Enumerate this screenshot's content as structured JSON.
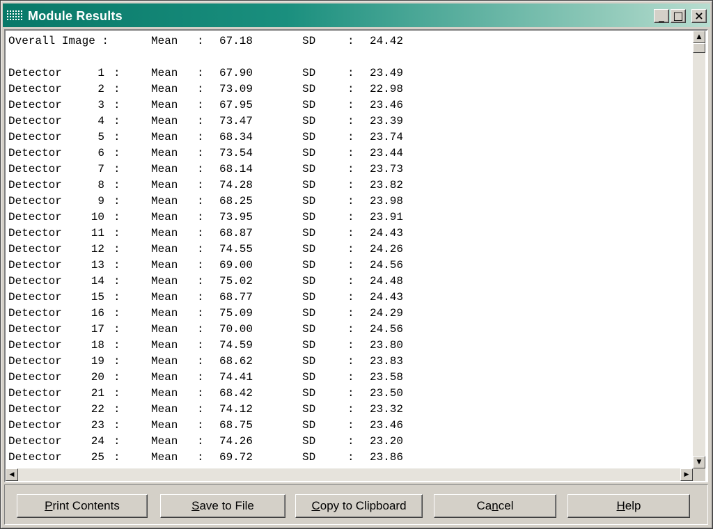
{
  "window": {
    "title": "Module Results",
    "controls": {
      "minimize": "_",
      "maximize": "□",
      "close": "×"
    }
  },
  "overall": {
    "label": "Overall Image :",
    "mean_label": "Mean",
    "mean": "67.18",
    "sd_label": "SD",
    "sd": "24.42"
  },
  "detectors": [
    {
      "num": "1",
      "mean": "67.90",
      "sd": "23.49"
    },
    {
      "num": "2",
      "mean": "73.09",
      "sd": "22.98"
    },
    {
      "num": "3",
      "mean": "67.95",
      "sd": "23.46"
    },
    {
      "num": "4",
      "mean": "73.47",
      "sd": "23.39"
    },
    {
      "num": "5",
      "mean": "68.34",
      "sd": "23.74"
    },
    {
      "num": "6",
      "mean": "73.54",
      "sd": "23.44"
    },
    {
      "num": "7",
      "mean": "68.14",
      "sd": "23.73"
    },
    {
      "num": "8",
      "mean": "74.28",
      "sd": "23.82"
    },
    {
      "num": "9",
      "mean": "68.25",
      "sd": "23.98"
    },
    {
      "num": "10",
      "mean": "73.95",
      "sd": "23.91"
    },
    {
      "num": "11",
      "mean": "68.87",
      "sd": "24.43"
    },
    {
      "num": "12",
      "mean": "74.55",
      "sd": "24.26"
    },
    {
      "num": "13",
      "mean": "69.00",
      "sd": "24.56"
    },
    {
      "num": "14",
      "mean": "75.02",
      "sd": "24.48"
    },
    {
      "num": "15",
      "mean": "68.77",
      "sd": "24.43"
    },
    {
      "num": "16",
      "mean": "75.09",
      "sd": "24.29"
    },
    {
      "num": "17",
      "mean": "70.00",
      "sd": "24.56"
    },
    {
      "num": "18",
      "mean": "74.59",
      "sd": "23.80"
    },
    {
      "num": "19",
      "mean": "68.62",
      "sd": "23.83"
    },
    {
      "num": "20",
      "mean": "74.41",
      "sd": "23.58"
    },
    {
      "num": "21",
      "mean": "68.42",
      "sd": "23.50"
    },
    {
      "num": "22",
      "mean": "74.12",
      "sd": "23.32"
    },
    {
      "num": "23",
      "mean": "68.75",
      "sd": "23.46"
    },
    {
      "num": "24",
      "mean": "74.26",
      "sd": "23.20"
    },
    {
      "num": "25",
      "mean": "69.72",
      "sd": "23.86"
    }
  ],
  "labels": {
    "detector": "Detector",
    "mean": "Mean",
    "sd": "SD",
    "colon": ":"
  },
  "buttons": {
    "print": {
      "mnemonic": "P",
      "rest": "rint Contents"
    },
    "save": {
      "mnemonic": "S",
      "rest": "ave to File"
    },
    "copy": {
      "mnemonic": "C",
      "rest": "opy to Clipboard"
    },
    "cancel": {
      "pre": "Ca",
      "mnemonic": "n",
      "rest": "cel"
    },
    "help": {
      "mnemonic": "H",
      "rest": "elp"
    }
  },
  "scroll_arrows": {
    "up": "▲",
    "down": "▼",
    "left": "◀",
    "right": "▶"
  },
  "colors": {
    "titlebar_start": "#087868",
    "titlebar_end": "#b8ddd0",
    "face": "#d4d0c8"
  }
}
